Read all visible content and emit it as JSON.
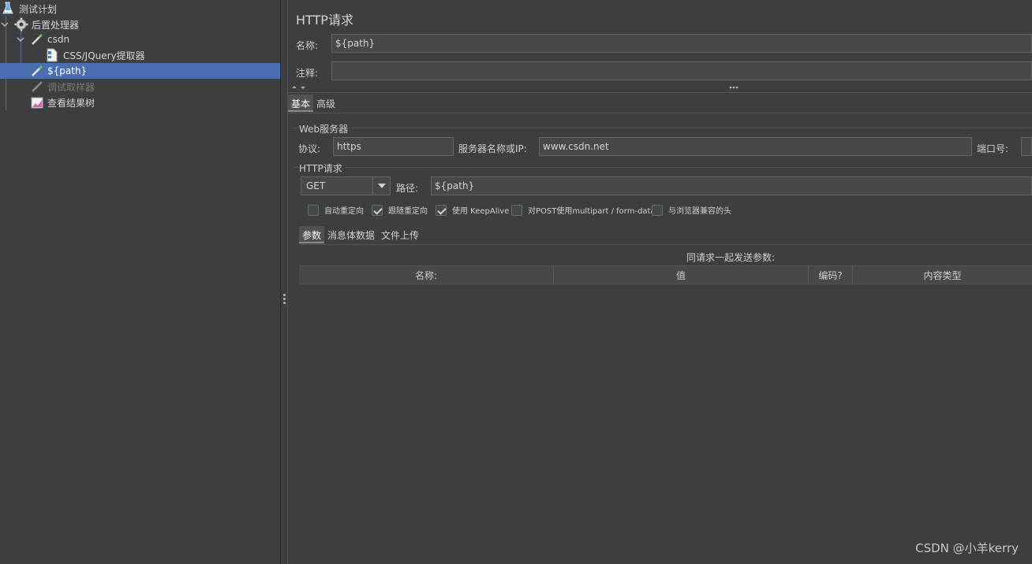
{
  "tree": {
    "items": [
      {
        "label": "测试计划",
        "icon": "flask-icon"
      },
      {
        "label": "后置处理器",
        "icon": "gear-icon"
      },
      {
        "label": "csdn",
        "icon": "pipette-icon"
      },
      {
        "label": "CSS/JQuery提取器",
        "icon": "document-icon"
      },
      {
        "label": "${path}",
        "icon": "pipette-icon"
      },
      {
        "label": "调试取样器",
        "icon": "pipette-icon"
      },
      {
        "label": "查看结果树",
        "icon": "chart-icon"
      }
    ]
  },
  "panel": {
    "title": "HTTP请求",
    "name_label": "名称:",
    "name_value": "${path}",
    "comment_label": "注释:",
    "comment_value": "",
    "tabs": [
      "基本",
      "高级"
    ],
    "web_server": {
      "group_title": "Web服务器",
      "protocol_label": "协议:",
      "protocol_value": "https",
      "server_label": "服务器名称或IP:",
      "server_value": "www.csdn.net",
      "port_label": "端口号:"
    },
    "http_request": {
      "group_title": "HTTP请求",
      "method": "GET",
      "path_label": "路径:",
      "path_value": "${path}"
    },
    "checkboxes": [
      {
        "label": "自动重定向",
        "checked": false
      },
      {
        "label": "跟随重定向",
        "checked": true
      },
      {
        "label": "使用 KeepAlive",
        "checked": true
      },
      {
        "label": "对POST使用multipart / form-data",
        "checked": false
      },
      {
        "label": "与浏览器兼容的头",
        "checked": false
      }
    ],
    "sub_tabs": [
      "参数",
      "消息体数据",
      "文件上传"
    ],
    "params_caption": "同请求一起发送参数:",
    "columns": [
      "名称:",
      "值",
      "编码?",
      "内容类型"
    ]
  },
  "watermark": "CSDN @小羊kerry"
}
